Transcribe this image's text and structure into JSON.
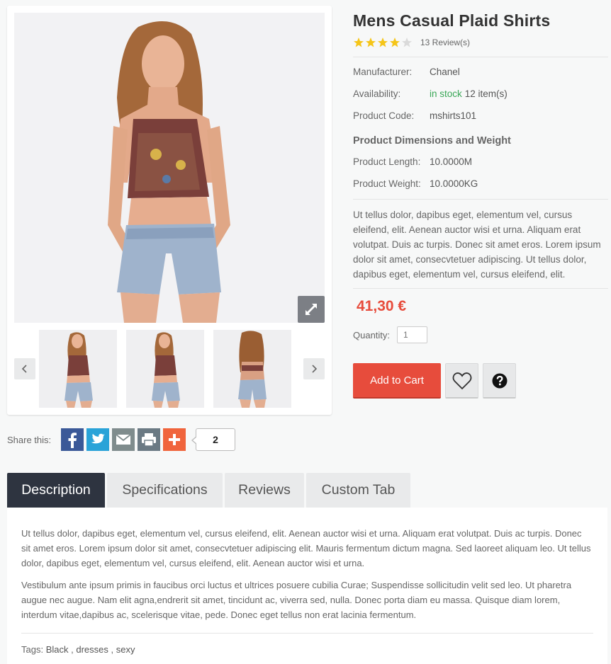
{
  "product": {
    "title": "Mens Casual Plaid Shirts",
    "rating": 4,
    "rating_max": 5,
    "reviews_label": "13 Review(s)",
    "specs": [
      {
        "label": "Manufacturer:",
        "value": "Chanel"
      },
      {
        "label": "Availability:",
        "value_stock": "in stock",
        "value_items": "12 item(s)"
      },
      {
        "label": "Product Code:",
        "value": "mshirts101"
      }
    ],
    "dimensions_title": "Product Dimensions and Weight",
    "dimensions": [
      {
        "label": "Product Length:",
        "value": "10.0000M"
      },
      {
        "label": "Product Weight:",
        "value": "10.0000KG"
      }
    ],
    "short_description": "Ut tellus dolor, dapibus eget, elementum vel, cursus eleifend, elit. Aenean auctor wisi et urna. Aliquam erat volutpat. Duis ac turpis. Donec sit amet eros. Lorem ipsum dolor sit amet, consecvtetuer adipiscing. Ut tellus dolor, dapibus eget, elementum vel, cursus eleifend, elit.",
    "price": "41,30 €",
    "quantity_label": "Quantity:",
    "quantity_value": "1",
    "add_to_cart": "Add to Cart"
  },
  "gallery": {
    "zoom_icon": "expand-icon",
    "prev_icon": "chevron-left-icon",
    "next_icon": "chevron-right-icon"
  },
  "share": {
    "label": "Share this:",
    "count": "2",
    "networks": [
      "facebook",
      "twitter",
      "email",
      "print",
      "more"
    ]
  },
  "tabs": [
    {
      "label": "Description",
      "active": true
    },
    {
      "label": "Specifications",
      "active": false
    },
    {
      "label": "Reviews",
      "active": false
    },
    {
      "label": "Custom Tab",
      "active": false
    }
  ],
  "description": {
    "p1": "Ut tellus dolor, dapibus eget, elementum vel, cursus eleifend, elit. Aenean auctor wisi et urna. Aliquam erat volutpat. Duis ac turpis. Donec sit amet eros. Lorem ipsum dolor sit amet, consecvtetuer adipiscing elit. Mauris fermentum dictum magna. Sed laoreet aliquam leo. Ut tellus dolor, dapibus eget, elementum vel, cursus eleifend, elit. Aenean auctor wisi et urna.",
    "p2": "Vestibulum ante ipsum primis in faucibus orci luctus et ultrices posuere cubilia Curae; Suspendisse sollicitudin velit sed leo. Ut pharetra augue nec augue. Nam elit agna,endrerit sit amet, tincidunt ac, viverra sed, nulla. Donec porta diam eu massa. Quisque diam lorem, interdum vitae,dapibus ac, scelerisque vitae, pede. Donec eget tellus non erat lacinia fermentum.",
    "tags_label": "Tags:",
    "tags": [
      "Black",
      "dresses",
      "sexy"
    ],
    "tag_sep": ","
  },
  "colors": {
    "price": "#e74c3c",
    "in_stock": "#3aa757",
    "star": "#f5c518",
    "tab_active": "#2e3440"
  }
}
